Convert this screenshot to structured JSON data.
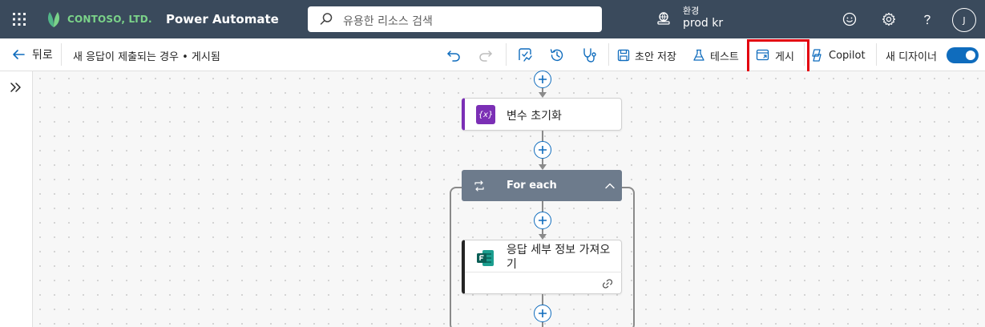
{
  "header": {
    "company": "CONTOSO, LTD.",
    "app_title": "Power Automate",
    "search_placeholder": "유용한 리소스 검색",
    "environment_label": "환경",
    "environment_name": "prod kr",
    "avatar_initial": "J"
  },
  "commandbar": {
    "back_label": "뒤로",
    "flow_name": "새 응답이 제출되는 경우 • 게시됨",
    "save_draft_label": "초안 저장",
    "test_label": "테스트",
    "publish_label": "게시",
    "copilot_label": "Copilot",
    "new_designer_label": "새 디자이너",
    "new_designer_enabled": true,
    "publish_tooltip": "게시"
  },
  "canvas": {
    "var_card_title": "변수 초기화",
    "var_icon_text": "{x}",
    "foreach_title": "For each",
    "response_card_title_line1": "응답 세부 정보 가져오",
    "response_card_title_line2": "기"
  },
  "colors": {
    "header_bg": "#3a4a5c",
    "accent": "#0f6cbd",
    "highlight": "#e3000f",
    "variable": "#7b2fb5",
    "foreach": "#6d7b8c"
  }
}
